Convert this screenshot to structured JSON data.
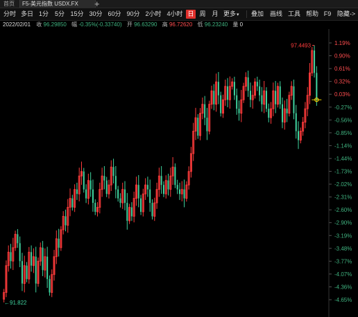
{
  "tabs": {
    "home": "首页",
    "active": "F5-美元指数 USDX.FX",
    "add": "+"
  },
  "toolbar": {
    "items": [
      "分时",
      "多日",
      "1分",
      "5分",
      "15分",
      "30分",
      "60分",
      "90分",
      "2小时",
      "4小时",
      "日",
      "周",
      "月",
      "更多",
      "叠加",
      "画线",
      "工具",
      "帮助",
      "F9",
      "隐藏->"
    ],
    "selected": "日",
    "more_arrow": "▾"
  },
  "info": {
    "date": "2022/02/01",
    "close_label": "收",
    "close": "96.29850",
    "change_label": "幅",
    "change": "-0.35%(-0.33740)",
    "open_label": "开",
    "open": "96.63290",
    "high_label": "高",
    "high": "96.72620",
    "low_label": "低",
    "low": "96.23240",
    "vol_label": "量",
    "vol": "0"
  },
  "colors": {
    "up": "#ff3b3b",
    "down": "#3fd29e",
    "bg": "#000000",
    "axis_up": "#ff4d4f",
    "axis_down": "#3fb27f",
    "marker": "#f0d000"
  },
  "chart_data": {
    "type": "candlestick",
    "y_axis_percent_labels": [
      "1.19%",
      "0.90%",
      "0.61%",
      "0.32%",
      "0.03%",
      "-0.27%",
      "-0.56%",
      "-0.85%",
      "-1.14%",
      "-1.44%",
      "-1.73%",
      "-2.02%",
      "-2.31%",
      "-2.60%",
      "-2.90%",
      "-3.19%",
      "-3.48%",
      "-3.77%",
      "-4.07%",
      "-4.36%",
      "-4.65%"
    ],
    "ylim": [
      91.7,
      97.6
    ],
    "high_annotation": "97.4493",
    "low_annotation": "91.822",
    "low_annotation_prefix": "←",
    "closes": [
      92.0,
      92.6,
      92.9,
      92.7,
      93.0,
      93.3,
      93.1,
      92.7,
      92.2,
      92.6,
      92.3,
      92.9,
      92.6,
      92.8,
      92.2,
      92.7,
      93.0,
      92.5,
      92.8,
      92.3,
      92.0,
      92.4,
      92.8,
      93.2,
      93.0,
      93.4,
      93.7,
      93.5,
      93.9,
      94.1,
      93.9,
      94.3,
      94.2,
      94.6,
      94.7,
      94.3,
      94.1,
      94.5,
      94.3,
      94.0,
      93.8,
      93.9,
      94.3,
      94.6,
      94.5,
      94.2,
      94.4,
      94.8,
      94.6,
      94.3,
      94.1,
      94.0,
      94.3,
      94.0,
      93.6,
      93.9,
      93.7,
      94.1,
      94.4,
      94.1,
      93.8,
      94.2,
      94.4,
      94.3,
      94.0,
      93.7,
      94.0,
      94.3,
      94.6,
      94.4,
      94.2,
      94.5,
      94.3,
      94.6,
      94.8,
      94.4,
      94.3,
      94.2,
      94.3,
      94.1,
      94.4,
      94.7,
      95.1,
      95.6,
      95.9,
      95.5,
      96.0,
      96.2,
      95.9,
      95.6,
      96.2,
      96.5,
      96.2,
      96.7,
      96.4,
      96.0,
      96.3,
      96.6,
      96.3,
      96.6,
      96.7,
      96.4,
      96.1,
      96.0,
      96.3,
      96.6,
      96.8,
      96.5,
      96.3,
      96.4,
      96.7,
      96.6,
      96.4,
      96.2,
      96.5,
      96.1,
      95.9,
      96.1,
      96.5,
      96.2,
      96.6,
      96.2,
      95.8,
      96.1,
      96.0,
      96.4,
      96.6,
      96.0,
      95.6,
      95.4,
      95.6,
      95.8,
      96.1,
      96.4,
      96.9,
      97.4,
      96.9,
      96.3
    ]
  }
}
